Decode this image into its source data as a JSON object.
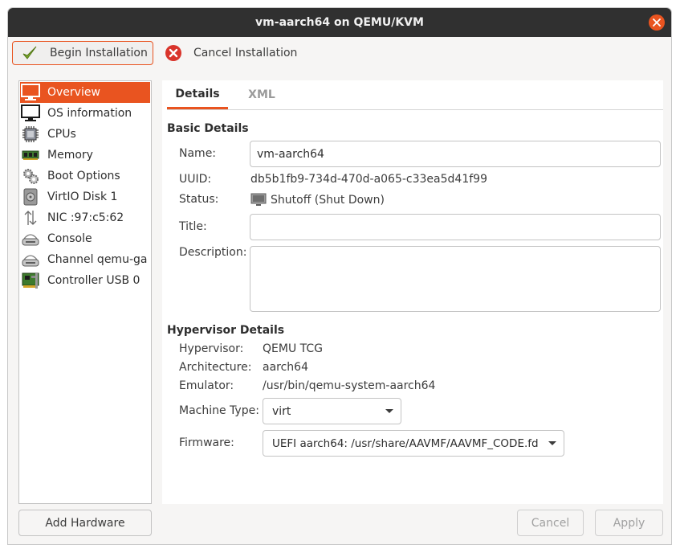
{
  "window": {
    "title": "vm-aarch64 on QEMU/KVM"
  },
  "toolbar": {
    "begin_label": "Begin Installation",
    "cancel_label": "Cancel Installation"
  },
  "sidebar": {
    "items": [
      {
        "label": "Overview",
        "icon": "monitor-icon",
        "selected": true
      },
      {
        "label": "OS information",
        "icon": "monitor-icon"
      },
      {
        "label": "CPUs",
        "icon": "cpu-chip-icon"
      },
      {
        "label": "Memory",
        "icon": "memory-module-icon"
      },
      {
        "label": "Boot Options",
        "icon": "gears-icon"
      },
      {
        "label": "VirtIO Disk 1",
        "icon": "disk-icon"
      },
      {
        "label": "NIC :97:c5:62",
        "icon": "network-arrows-icon"
      },
      {
        "label": "Console",
        "icon": "serial-device-icon"
      },
      {
        "label": "Channel qemu-ga",
        "icon": "serial-device-icon"
      },
      {
        "label": "Controller USB 0",
        "icon": "pci-card-icon"
      }
    ],
    "add_hardware_label": "Add Hardware"
  },
  "tabs": {
    "details": "Details",
    "xml": "XML"
  },
  "basic": {
    "section_title": "Basic Details",
    "name_label": "Name:",
    "name_value": "vm-aarch64",
    "uuid_label": "UUID:",
    "uuid_value": "db5b1fb9-734d-470d-a065-c33ea5d41f99",
    "status_label": "Status:",
    "status_value": "Shutoff (Shut Down)",
    "title_label": "Title:",
    "title_value": "",
    "description_label": "Description:",
    "description_value": ""
  },
  "hypervisor": {
    "section_title": "Hypervisor Details",
    "hypervisor_label": "Hypervisor:",
    "hypervisor_value": "QEMU TCG",
    "arch_label": "Architecture:",
    "arch_value": "aarch64",
    "emulator_label": "Emulator:",
    "emulator_value": "/usr/bin/qemu-system-aarch64",
    "machine_label": "Machine Type:",
    "machine_value": "virt",
    "firmware_label": "Firmware:",
    "firmware_value": "UEFI aarch64: /usr/share/AAVMF/AAVMF_CODE.fd"
  },
  "buttons": {
    "cancel": "Cancel",
    "apply": "Apply"
  },
  "colors": {
    "accent": "#e95420",
    "titlebar": "#303030",
    "background": "#f6f5f4"
  }
}
